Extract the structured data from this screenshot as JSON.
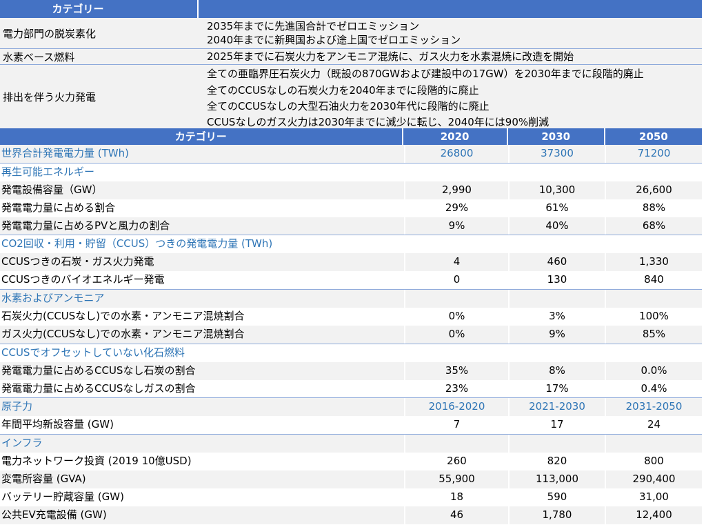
{
  "top_table": {
    "header": "カテゴリー",
    "rows": [
      {
        "category": "電力部門の脱炭素化",
        "details": [
          "2035年までに先進国合計でゼロエミッション",
          "2040年までに新興国および途上国でゼロエミッション"
        ]
      },
      {
        "category": "水素ベース燃料",
        "details": [
          "2025年までに石炭火力をアンモニア混焼に、ガス火力を水素混焼に改造を開始"
        ]
      },
      {
        "category": "排出を伴う火力発電",
        "details": [
          "全ての亜臨界圧石炭火力（既設の870GWおよび建設中の17GW）を2030年までに段階的廃止",
          "全てのCCUSなしの石炭火力を2040年までに段階的に廃止",
          "全てのCCUSなしの大型石油火力を2030年代に段階的に廃止",
          "CCUSなしのガス火力は2030年までに減少に転じ、2040年には90%削減"
        ]
      }
    ]
  },
  "bottom_table": {
    "header": {
      "label": "カテゴリー",
      "y1": "2020",
      "y2": "2030",
      "y3": "2050"
    },
    "rows": [
      {
        "label": "世界合計発電電力量 (TWh)",
        "v1": "26800",
        "v2": "37300",
        "v3": "71200",
        "type": "sec"
      },
      {
        "label": "再生可能エネルギー",
        "v1": "",
        "v2": "",
        "v3": "",
        "type": "sec"
      },
      {
        "label": "発電設備容量（GW）",
        "v1": "2,990",
        "v2": "10,300",
        "v3": "26,600",
        "type": "data"
      },
      {
        "label": "発電電力量に占める割合",
        "v1": "29%",
        "v2": "61%",
        "v3": "88%",
        "type": "data"
      },
      {
        "label": "発電電力量に占めるPVと風力の割合",
        "v1": "9%",
        "v2": "40%",
        "v3": "68%",
        "type": "data"
      },
      {
        "label": "CO2回収・利用・貯留（CCUS）つきの発電電力量 (TWh)",
        "v1": "",
        "v2": "",
        "v3": "",
        "type": "sec"
      },
      {
        "label": "CCUSつきの石炭・ガス火力発電",
        "v1": "4",
        "v2": "460",
        "v3": "1,330",
        "type": "data"
      },
      {
        "label": "CCUSつきのバイオエネルギー発電",
        "v1": "0",
        "v2": "130",
        "v3": "840",
        "type": "data"
      },
      {
        "label": "水素およびアンモニア",
        "v1": "",
        "v2": "",
        "v3": "",
        "type": "sec"
      },
      {
        "label": "石炭火力(CCUSなし)での水素・アンモニア混焼割合",
        "v1": "0%",
        "v2": "3%",
        "v3": "100%",
        "type": "data"
      },
      {
        "label": "ガス火力(CCUSなし)での水素・アンモニア混焼割合",
        "v1": "0%",
        "v2": "9%",
        "v3": "85%",
        "type": "data"
      },
      {
        "label": "CCUSでオフセットしていない化石燃料",
        "v1": "",
        "v2": "",
        "v3": "",
        "type": "sec"
      },
      {
        "label": "発電電力量に占めるCCUSなし石炭の割合",
        "v1": "35%",
        "v2": "8%",
        "v3": "0.0%",
        "type": "data"
      },
      {
        "label": "発電電力量に占めるCCUSなしガスの割合",
        "v1": "23%",
        "v2": "17%",
        "v3": "0.4%",
        "type": "data"
      },
      {
        "label": "原子力",
        "v1": "2016-2020",
        "v2": "2021-2030",
        "v3": "2031-2050",
        "type": "sec"
      },
      {
        "label": "年間平均新設容量 (GW)",
        "v1": "7",
        "v2": "17",
        "v3": "24",
        "type": "data"
      },
      {
        "label": "インフラ",
        "v1": "",
        "v2": "",
        "v3": "",
        "type": "sec"
      },
      {
        "label": "電力ネットワーク投資 (2019 10億USD)",
        "v1": "260",
        "v2": "820",
        "v3": "800",
        "type": "data"
      },
      {
        "label": "変電所容量 (GVA)",
        "v1": "55,900",
        "v2": "113,000",
        "v3": "290,400",
        "type": "data"
      },
      {
        "label": "バッテリー貯蔵容量 (GW)",
        "v1": "18",
        "v2": "590",
        "v3": "31,00",
        "type": "data"
      },
      {
        "label": "公共EV充電設備 (GW)",
        "v1": "46",
        "v2": "1,780",
        "v3": "12,400",
        "type": "data"
      }
    ]
  }
}
